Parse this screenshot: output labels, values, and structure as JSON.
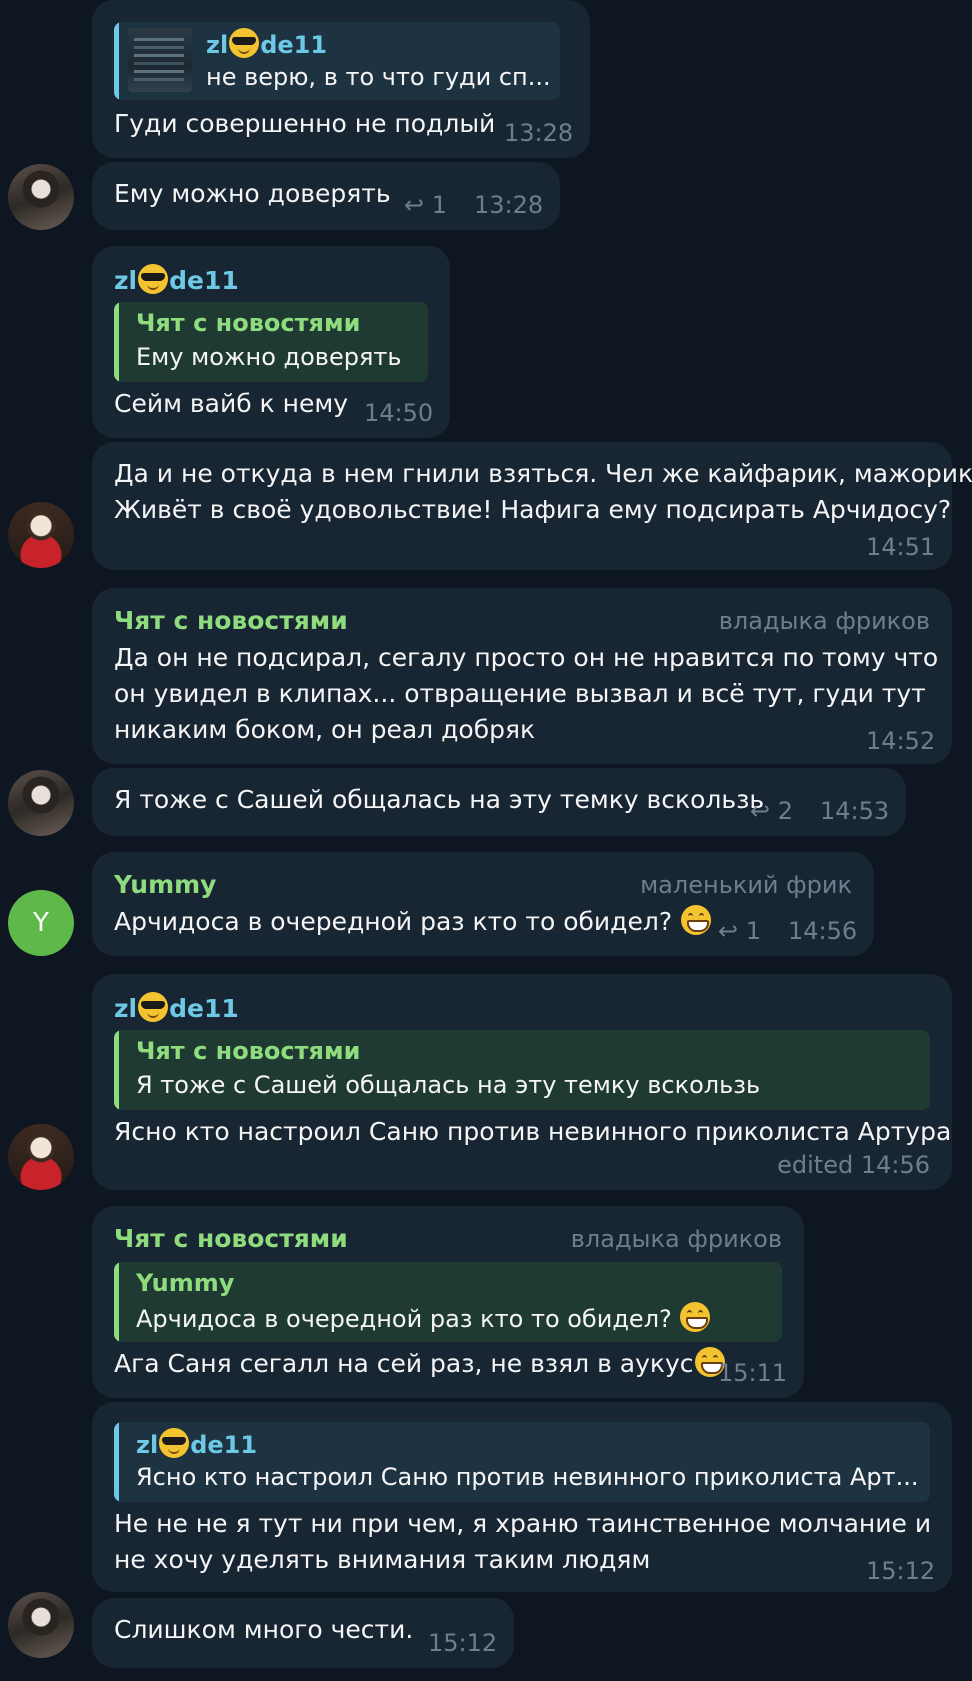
{
  "messages": [
    {
      "reply": {
        "sender": "zl",
        "sender_suffix": "de11",
        "text": "не верю, в то что гуди сп..."
      },
      "text": "Гуди совершенно не подлый",
      "time": "13:28"
    },
    {
      "text": "Ему можно доверять",
      "replies": "1",
      "time": "13:28"
    },
    {
      "sender": "zl",
      "sender_suffix": "de11",
      "reply": {
        "sender": "Чят с новостями",
        "text": "Ему можно доверять"
      },
      "text": "Сейм вайб к нему",
      "time": "14:50"
    },
    {
      "lines": [
        "Да и не откуда в нем гнили взяться. Чел же кайфарик, мажорик.",
        "Живёт в своё удовольствие! Нафига ему подсирать Арчидосу?"
      ],
      "time": "14:51"
    },
    {
      "sender": "Чят с новостями",
      "tag": "владыка фриков",
      "lines": [
        "Да он не подсирал, сегалу просто он не нравится по тому что",
        "он увидел в клипах... отвращение вызвал и всё тут, гуди тут",
        "никаким боком, он реал добряк"
      ],
      "time": "14:52"
    },
    {
      "text": "Я тоже с Сашей общалась на эту темку вскользь",
      "replies": "2",
      "time": "14:53"
    },
    {
      "sender": "Yummy",
      "tag": "маленький фрик",
      "text": "Арчидоса в очередной раз кто то обидел?",
      "replies": "1",
      "time": "14:56",
      "avatar_letter": "Y"
    },
    {
      "sender": "zl",
      "sender_suffix": "de11",
      "reply": {
        "sender": "Чят с новостями",
        "text": "Я тоже с Сашей общалась на эту темку вскользь"
      },
      "text": "Ясно кто настроил Саню против невинного приколиста Артура",
      "time": "edited 14:56"
    },
    {
      "sender": "Чят с новостями",
      "tag": "владыка фриков",
      "reply": {
        "sender": "Yummy",
        "text": "Арчидоса в очередной раз кто то обидел?"
      },
      "text": "Ага Саня сегалл на сей раз, не взял в аукус",
      "time": "15:11"
    },
    {
      "reply": {
        "sender": "zl",
        "sender_suffix": "de11",
        "text": "Ясно кто настроил Саню против невинного приколиста Арт..."
      },
      "lines": [
        "Не не не я тут ни при чем, я храню таинственное молчание и",
        "не хочу уделять внимания таким людям"
      ],
      "time": "15:12"
    },
    {
      "text": "Слишком много чести.",
      "time": "15:12"
    }
  ],
  "icons": {
    "reply_count": "reply-arrow-icon",
    "emoji_cool": "sunglasses-emoji-icon",
    "emoji_grin": "grinning-emoji-icon"
  },
  "colors": {
    "background": "#0e1621",
    "bubble": "#182533",
    "accent_cyan": "#6ec9e6",
    "accent_green": "#8fdc7e",
    "meta": "#6d7f8f"
  }
}
